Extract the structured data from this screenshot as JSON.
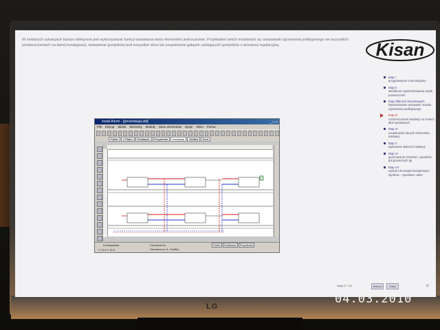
{
  "slide": {
    "intro_text": "W niektórych sytuacjach bardzo efektywne jest wykorzystanie funkcji wstawiania wielu elementów jednocześnie. Przykładem takich możliwości są: wstawianie ogrzewania podłogowego we wszystkich pomieszczeniach na danej kondygnacji, wstawienie grzejników pod wszystkie okna lub uzupełnienie gałązek zasilających grzejników o armaturę regulacyjną.",
    "logo_text": "Kisan",
    "nav": [
      {
        "name": "Etap I",
        "desc": "przygotowanie rzutu budynku",
        "active": false
      },
      {
        "name": "Etap II",
        "desc": "określenie zapotrzebowania ciepła pomieszczeń",
        "active": false
      },
      {
        "name": "Etap Obliczeń Zaczekowych",
        "desc": "Wymiarowanie rysowanie modułu ogrzewania podłogowego",
        "active": false
      },
      {
        "name": "Etap III",
        "desc": "rozmieszczenie instalacji na rzutach dłuż rysowanych",
        "active": true
      },
      {
        "name": "Etap IV",
        "desc": "uzupełnienie danych elementów instalacji",
        "active": false
      },
      {
        "name": "Etap V",
        "desc": "wykonanie obliczeń instalacji",
        "active": false
      },
      {
        "name": "Etap VI",
        "desc": "generowanie rozwinięć, rysunków pół grzewczych itp.",
        "active": false
      },
      {
        "name": "Etap VII",
        "desc": "wydruk lub eksport kompletnych wyników - rysunków i tabel",
        "active": false
      }
    ],
    "footer": {
      "page": "Slajd 27 / 61",
      "prev": "Wstecz",
      "next": "Dalej"
    }
  },
  "app": {
    "title": "Instal-therm - [prezentacja.std]",
    "window_buttons": "_ □ ×",
    "menu": [
      "Plik",
      "Edycja",
      "Widok",
      "Elementy",
      "Moduły",
      "Dane elementów",
      "Opcje",
      "Okno",
      "Pomoc"
    ],
    "tabs": [
      "Parter",
      "1 Piętro",
      "Poddasze",
      "Przyziemie",
      "Instalacja",
      "Grafika",
      "Rzut"
    ],
    "selected_tab_index": 4,
    "status": {
      "layer": "Kondygnacja",
      "selection": "Zaznaczenie:",
      "selection_detail": "Zaznaczono: 8 / Grafika",
      "coords": "X 74.6  Y 32.5",
      "bottom_tabs": [
        "Parter",
        "Poddasze",
        "Przyziemie"
      ]
    }
  },
  "date_stamp": "04.03.2010",
  "monitor_brand": "LG",
  "colors": {
    "pipe_supply": "#d01818",
    "pipe_return": "#2030d0",
    "title_bar": "#0a246a",
    "nav_active": "#c03030"
  }
}
